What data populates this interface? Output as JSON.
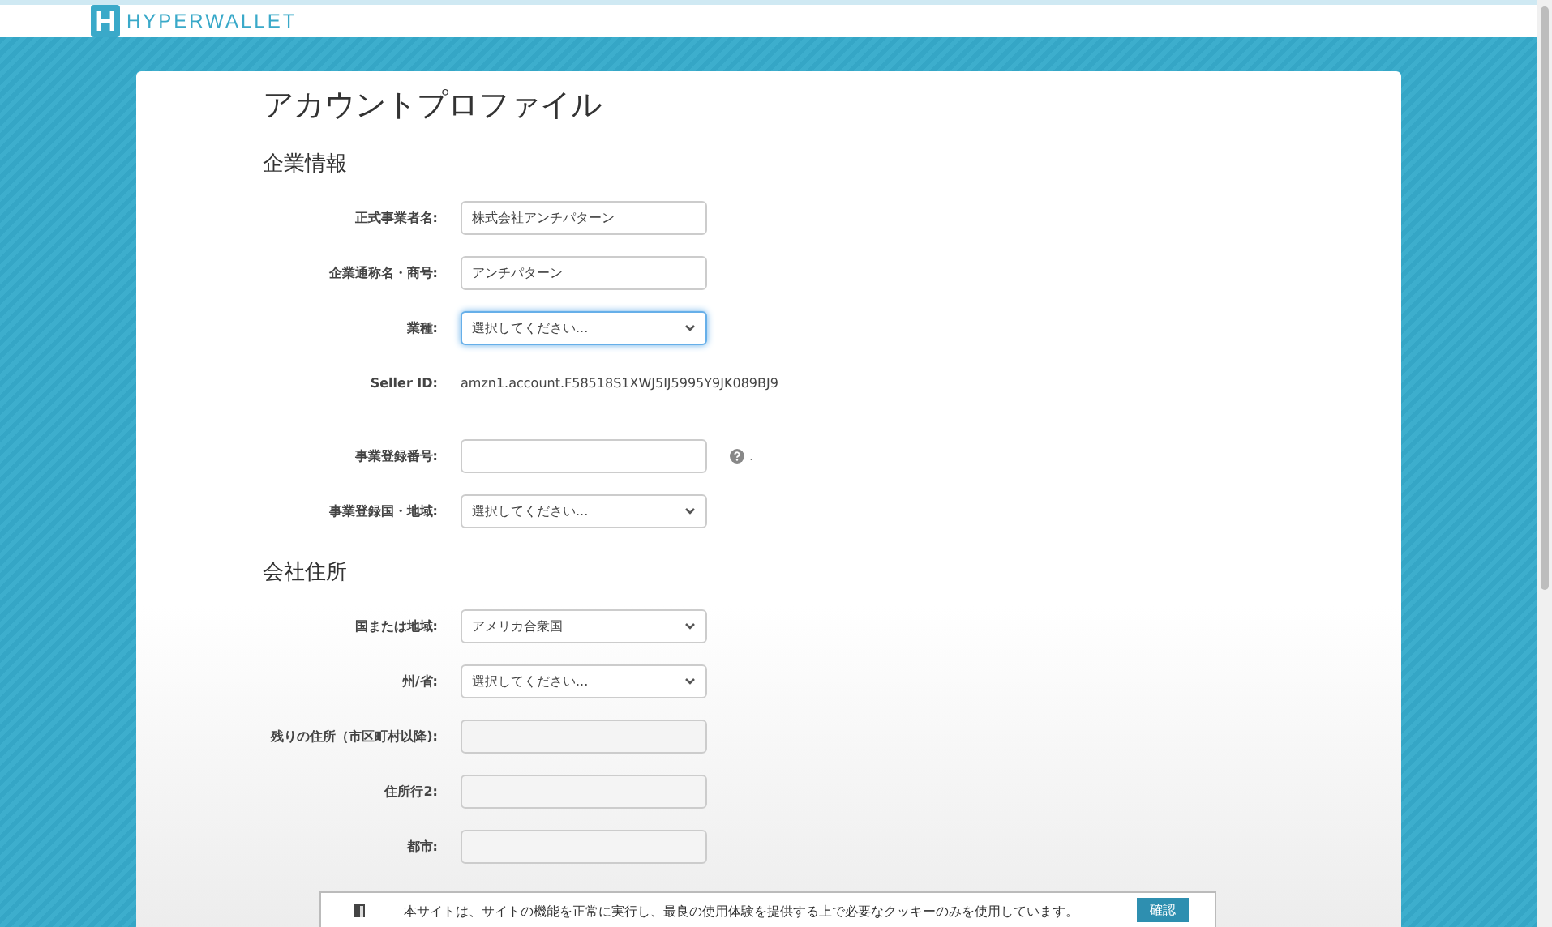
{
  "header": {
    "logo_text": "HYPERWALLET"
  },
  "page": {
    "title": "アカウントプロファイル"
  },
  "sections": [
    {
      "heading": "企業情報",
      "fields": [
        {
          "kind": "text",
          "label": "正式事業者名:",
          "value": "株式会社アンチパターン",
          "focused": false
        },
        {
          "kind": "text",
          "label": "企業通称名・商号:",
          "value": "アンチパターン",
          "focused": false
        },
        {
          "kind": "select",
          "label": "業種:",
          "value": "選択してください...",
          "focused": true
        },
        {
          "kind": "static",
          "label": "Seller ID:",
          "value": "amzn1.account.F58518S1XWJ5IJ5995Y9JK089BJ9"
        },
        {
          "kind": "help",
          "label": "事業登録番号:",
          "suffix": ".",
          "focused": false
        },
        {
          "kind": "select",
          "label": "事業登録国・地域:",
          "value": "選択してください...",
          "focused": false
        }
      ]
    },
    {
      "heading": "会社住所",
      "fields": [
        {
          "kind": "select",
          "label": "国または地域:",
          "value": "アメリカ合衆国",
          "focused": false
        },
        {
          "kind": "select",
          "label": "州/省:",
          "value": "選択してください...",
          "focused": false
        },
        {
          "kind": "text",
          "label": "残りの住所（市区町村以降):",
          "focused": false
        },
        {
          "kind": "text",
          "label": "住所行2:",
          "focused": false
        },
        {
          "kind": "text",
          "label": "都市:",
          "focused": false
        }
      ]
    }
  ],
  "cookie_banner": {
    "message": "本サイトは、サイトの機能を正常に実行し、最良の使用体験を提供する上で必要なクッキーのみを使用しています。",
    "button": "確認"
  }
}
